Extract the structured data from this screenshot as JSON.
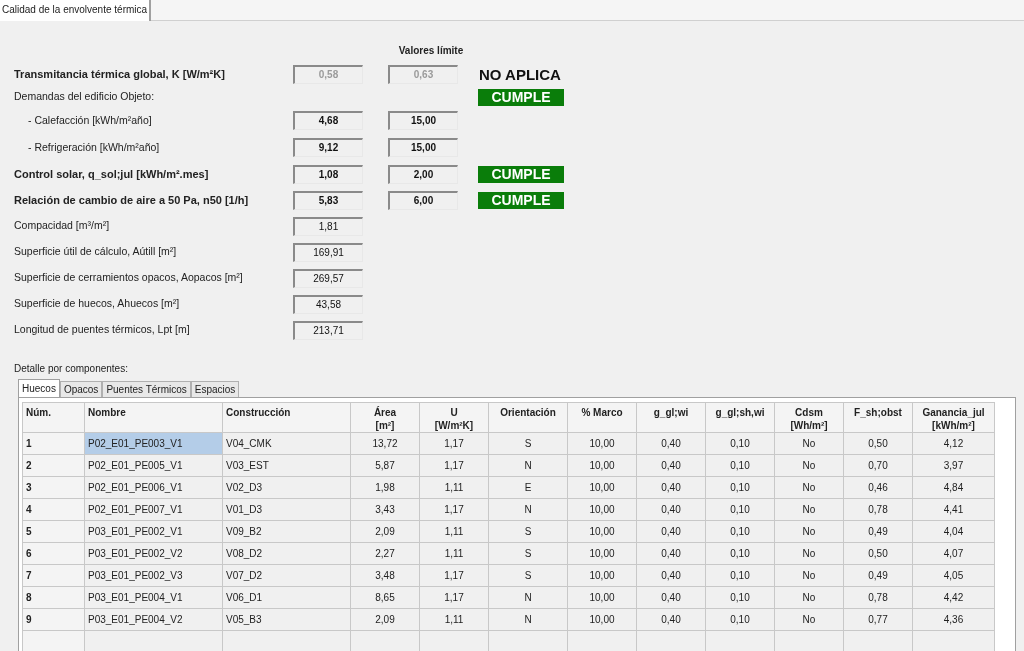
{
  "window_tabs": [
    {
      "label": "Calidad de la envolvente térmica",
      "selected": true
    }
  ],
  "limits_header": "Valores límite",
  "rows": [
    {
      "label": "Transmitancia térmica global, K [W/m²K]",
      "bold": true,
      "value": "0,58",
      "limit": "0,63",
      "disabled": true,
      "status": {
        "kind": "text",
        "text": "NO APLICA"
      }
    },
    {
      "label": "Demandas del edificio Objeto:",
      "bold": false,
      "status": {
        "kind": "badge",
        "text": "CUMPLE"
      },
      "children": [
        {
          "label": "- Calefacción [kWh/m²año]",
          "bold": false,
          "value": "4,68",
          "limit": "15,00",
          "disabled": false
        },
        {
          "label": "- Refrigeración [kWh/m²año]",
          "bold": false,
          "value": "9,12",
          "limit": "15,00",
          "disabled": false
        }
      ]
    },
    {
      "label": "Control solar, q_sol;jul [kWh/m².mes]",
      "bold": true,
      "value": "1,08",
      "limit": "2,00",
      "disabled": false,
      "status": {
        "kind": "badge",
        "text": "CUMPLE"
      }
    },
    {
      "label": "Relación de cambio de aire a 50 Pa, n50 [1/h]",
      "bold": true,
      "value": "5,83",
      "limit": "6,00",
      "disabled": false,
      "status": {
        "kind": "badge",
        "text": "CUMPLE"
      }
    },
    {
      "label": "Compacidad [m³/m²]",
      "bold": false,
      "value": "1,81",
      "disabled": false
    },
    {
      "label": "Superficie útil de cálculo, Aútill [m²]",
      "bold": false,
      "value": "169,91",
      "disabled": false
    },
    {
      "label": "Superficie de cerramientos opacos, Aopacos [m²]",
      "bold": false,
      "value": "269,57",
      "disabled": false
    },
    {
      "label": "Superficie de huecos, Ahuecos [m²]",
      "bold": false,
      "value": "43,58",
      "disabled": false
    },
    {
      "label": "Longitud de puentes térmicos, Lpt [m]",
      "bold": false,
      "value": "213,71",
      "disabled": false
    }
  ],
  "detail_label": "Detalle por componentes:",
  "detail_tabs": [
    {
      "label": "Huecos",
      "selected": true
    },
    {
      "label": "Opacos",
      "selected": false
    },
    {
      "label": "Puentes Térmicos",
      "selected": false
    },
    {
      "label": "Espacios",
      "selected": false
    }
  ],
  "table": {
    "columns": [
      {
        "label": "Núm."
      },
      {
        "label": "Nombre"
      },
      {
        "label": "Construcción"
      },
      {
        "label": "Área",
        "unit": "[m²]"
      },
      {
        "label": "U",
        "unit": "[W/m²K]"
      },
      {
        "label": "Orientación"
      },
      {
        "label": "% Marco"
      },
      {
        "label": "g_gl;wi"
      },
      {
        "label": "g_gl;sh,wi"
      },
      {
        "label": "Cdsm",
        "unit": "[Wh/m²]"
      },
      {
        "label": "F_sh;obst"
      },
      {
        "label": "Ganancia_jul",
        "unit": "[kWh/m²]"
      }
    ],
    "rows": [
      {
        "selected": true,
        "cells": [
          "1",
          "P02_E01_PE003_V1",
          "V04_CMK",
          "13,72",
          "1,17",
          "S",
          "10,00",
          "0,40",
          "0,10",
          "No",
          "0,50",
          "4,12"
        ]
      },
      {
        "selected": false,
        "cells": [
          "2",
          "P02_E01_PE005_V1",
          "V03_EST",
          "5,87",
          "1,17",
          "N",
          "10,00",
          "0,40",
          "0,10",
          "No",
          "0,70",
          "3,97"
        ]
      },
      {
        "selected": false,
        "cells": [
          "3",
          "P02_E01_PE006_V1",
          "V02_D3",
          "1,98",
          "1,11",
          "E",
          "10,00",
          "0,40",
          "0,10",
          "No",
          "0,46",
          "4,84"
        ]
      },
      {
        "selected": false,
        "cells": [
          "4",
          "P02_E01_PE007_V1",
          "V01_D3",
          "3,43",
          "1,17",
          "N",
          "10,00",
          "0,40",
          "0,10",
          "No",
          "0,78",
          "4,41"
        ]
      },
      {
        "selected": false,
        "cells": [
          "5",
          "P03_E01_PE002_V1",
          "V09_B2",
          "2,09",
          "1,11",
          "S",
          "10,00",
          "0,40",
          "0,10",
          "No",
          "0,49",
          "4,04"
        ]
      },
      {
        "selected": false,
        "cells": [
          "6",
          "P03_E01_PE002_V2",
          "V08_D2",
          "2,27",
          "1,11",
          "S",
          "10,00",
          "0,40",
          "0,10",
          "No",
          "0,50",
          "4,07"
        ]
      },
      {
        "selected": false,
        "cells": [
          "7",
          "P03_E01_PE002_V3",
          "V07_D2",
          "3,48",
          "1,17",
          "S",
          "10,00",
          "0,40",
          "0,10",
          "No",
          "0,49",
          "4,05"
        ]
      },
      {
        "selected": false,
        "cells": [
          "8",
          "P03_E01_PE004_V1",
          "V06_D1",
          "8,65",
          "1,17",
          "N",
          "10,00",
          "0,40",
          "0,10",
          "No",
          "0,78",
          "4,42"
        ]
      },
      {
        "selected": false,
        "cells": [
          "9",
          "P03_E01_PE004_V2",
          "V05_B3",
          "2,09",
          "1,11",
          "N",
          "10,00",
          "0,40",
          "0,10",
          "No",
          "0,77",
          "4,36"
        ]
      }
    ]
  }
}
